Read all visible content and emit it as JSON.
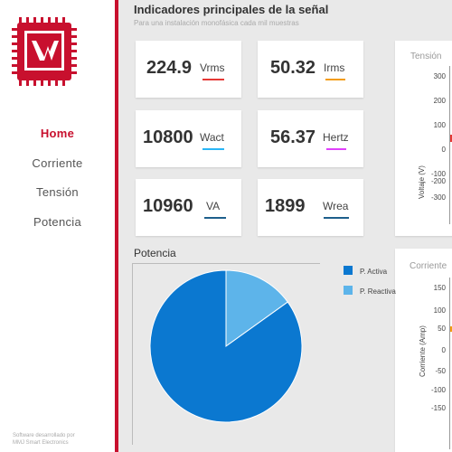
{
  "sidebar": {
    "nav": [
      {
        "label": "Home",
        "active": true
      },
      {
        "label": "Corriente",
        "active": false
      },
      {
        "label": "Tensión",
        "active": false
      },
      {
        "label": "Potencia",
        "active": false
      }
    ],
    "credits_line1": "Software desarrollado por",
    "credits_line2": "MMJ Smart Electronics"
  },
  "header": {
    "title": "Indicadores principales de la señal",
    "subtitle": "Para una instalación monofásica cada mil muestras"
  },
  "indicators": [
    {
      "value": "224.9",
      "unit": "Vrms",
      "underline_color": "#e53935"
    },
    {
      "value": "50.32",
      "unit": "Irms",
      "underline_color": "#f39c12"
    },
    {
      "value": "10800",
      "unit": "Wact",
      "underline_color": "#29b6f6"
    },
    {
      "value": "56.37",
      "unit": "Hertz",
      "underline_color": "#e040fb"
    },
    {
      "value": "10960",
      "unit": "VA",
      "underline_color": "#1e5f8c"
    },
    {
      "value": "1899",
      "unit": "Wrea",
      "underline_color": "#1e5f8c"
    }
  ],
  "voltage_panel": {
    "title": "Tensión",
    "ylabel": "Voltaje (V)",
    "ticks": [
      "300",
      "200",
      "100",
      "0",
      "-100",
      "-200",
      "-300"
    ]
  },
  "current_panel": {
    "title": "Corriente",
    "ylabel": "Corriente (Amp)",
    "ticks": [
      "150",
      "100",
      "50",
      "0",
      "-50",
      "-100",
      "-150"
    ]
  },
  "power_section": {
    "title": "Potencia"
  },
  "chart_data": {
    "type": "pie",
    "categories": [
      "P. Activa",
      "P. Reactiva"
    ],
    "values": [
      84.9,
      15.1
    ],
    "colors": [
      "#0b78d0",
      "#5db4ea"
    ],
    "legend_position": "right"
  },
  "colors": {
    "brand_red": "#c8102e",
    "background": "#e9e9e9"
  }
}
